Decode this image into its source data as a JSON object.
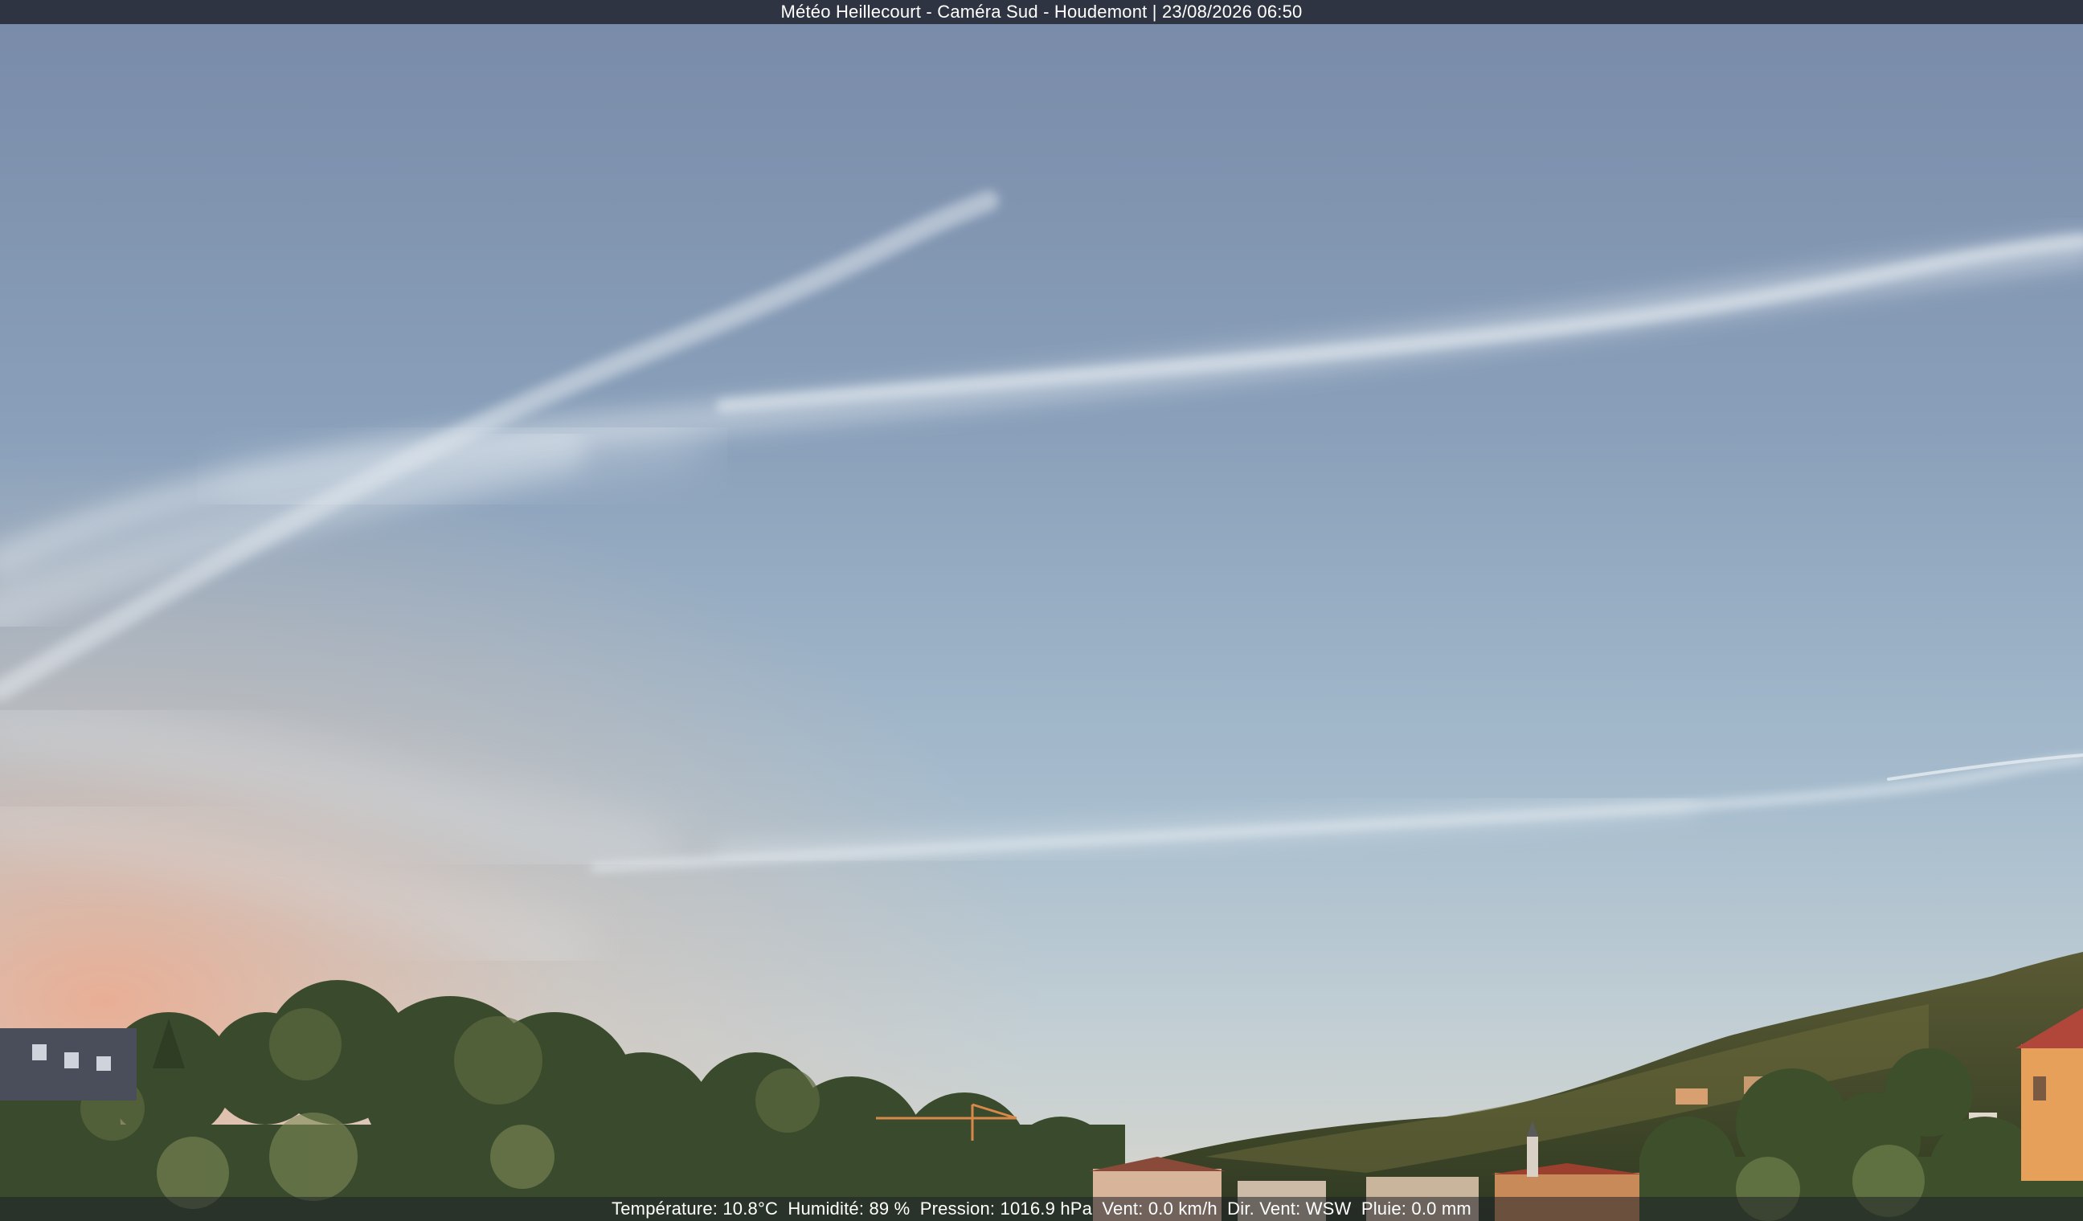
{
  "overlay": {
    "title": "Météo Heillecourt - Caméra Sud - Houdemont | 23/08/2026 06:50"
  },
  "weather": {
    "temperature": "Température: 10.8°C",
    "humidity": "Humidité: 89 %",
    "pressure": "Pression: 1016.9 hPa",
    "wind_speed": "Vent: 0.0 km/h",
    "wind_direction": "Dir. Vent: WSW",
    "rain": "Pluie: 0.0 mm"
  },
  "colors": {
    "sky_top": "#7a8dab",
    "sky_mid": "#9fb5c9",
    "horizon_warm": "#e9b79c",
    "vegetation": "#3b4a2a",
    "overlay_bar": "#282c38"
  }
}
